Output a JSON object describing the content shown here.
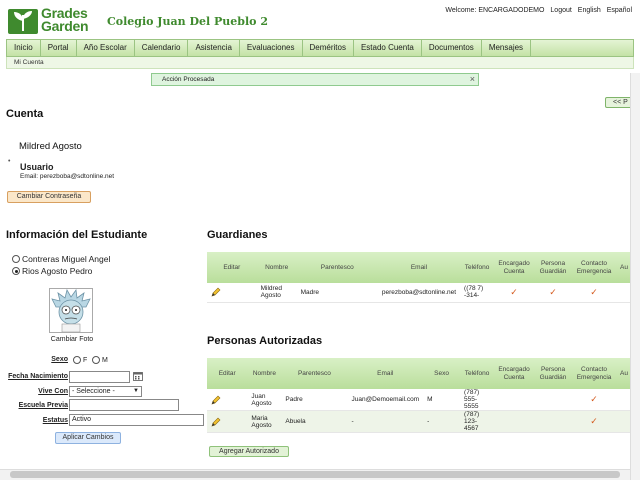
{
  "header": {
    "logo_line1": "Grades",
    "logo_line2": "Garden",
    "school_name": "Colegio Juan Del Pueblo 2",
    "welcome": "Welcome: ENCARGADODEMO",
    "logout": "Logout",
    "lang_en": "English",
    "lang_es": "Español"
  },
  "nav": {
    "items": [
      "Inicio",
      "Portal",
      "Año Escolar",
      "Calendario",
      "Asistencia",
      "Evaluaciones",
      "Deméritos",
      "Estado Cuenta",
      "Documentos",
      "Mensajes"
    ],
    "sub": "Mi Cuenta"
  },
  "alert": {
    "text": "Acción Procesada",
    "close": "×"
  },
  "prev_button": "<< P",
  "account": {
    "heading": "Cuenta",
    "name": "Mildred Agosto",
    "role": "Usuario",
    "email_line": "Email: perezboba@sdtonline.net",
    "change_password": "Cambiar Contraseña"
  },
  "student": {
    "heading": "Información del Estudiante",
    "options": [
      "Contreras Miguel Angel",
      "Rios Agosto Pedro"
    ],
    "selected_index": 1,
    "photo_caption": "Cambiar Foto",
    "labels": {
      "sexo": "Sexo",
      "nacimiento": "Fecha Nacimiento",
      "vive_con": "Vive Con",
      "escuela_previa": "Escuela Previa",
      "estatus": "Estatus"
    },
    "sexo_f": "F",
    "sexo_m": "M",
    "vive_con_value": "- Seleccione -",
    "estatus_value": "Activo",
    "apply_button": "Aplicar Cambios"
  },
  "guardians": {
    "heading": "Guardianes",
    "columns": [
      "Editar",
      "Nombre",
      "Parentesco",
      "Email",
      "Teléfono",
      "Encargado Cuenta",
      "Persona Guardián",
      "Contacto Emergencia",
      "Au"
    ],
    "rows": [
      {
        "nombre": "Mildred Agosto",
        "parentesco": "Madre",
        "email": "perezboba@sdtonline.net",
        "telefono": "((78 7) -314-",
        "encargado": "✓",
        "guardian": "✓",
        "emergencia": "✓"
      }
    ]
  },
  "authorized": {
    "heading": "Personas Autorizadas",
    "columns": [
      "Editar",
      "Nombre",
      "Parentesco",
      "Email",
      "Sexo",
      "Teléfono",
      "Encargado Cuenta",
      "Persona Guardián",
      "Contacto Emergencia",
      "Au"
    ],
    "rows": [
      {
        "nombre": "Juan Agosto",
        "parentesco": "Padre",
        "email": "Juan@Demoemail.com",
        "sexo": "M",
        "telefono": "(787) 555-5555",
        "emergencia": "✓"
      },
      {
        "nombre": "Maria Agosto",
        "parentesco": "Abuela",
        "email": "-",
        "sexo": "-",
        "telefono": "(787) 123-4567",
        "emergencia": "✓"
      }
    ],
    "add_button": "Agregar Autorizado"
  }
}
